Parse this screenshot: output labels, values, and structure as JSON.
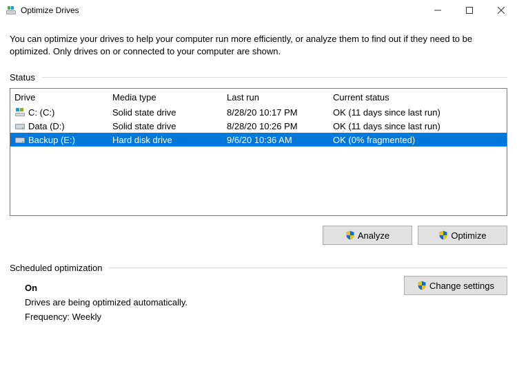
{
  "window": {
    "title": "Optimize Drives"
  },
  "intro": "You can optimize your drives to help your computer run more efficiently, or analyze them to find out if they need to be optimized. Only drives on or connected to your computer are shown.",
  "status_label": "Status",
  "columns": {
    "drive": "Drive",
    "media": "Media type",
    "last": "Last run",
    "status": "Current status"
  },
  "drives": [
    {
      "name": "C: (C:)",
      "media": "Solid state drive",
      "last": "8/28/20 10:17 PM",
      "status": "OK (11 days since last run)",
      "selected": false,
      "icon": "os"
    },
    {
      "name": "Data (D:)",
      "media": "Solid state drive",
      "last": "8/28/20 10:26 PM",
      "status": "OK (11 days since last run)",
      "selected": false,
      "icon": "hdd"
    },
    {
      "name": "Backup (E:)",
      "media": "Hard disk drive",
      "last": "9/6/20 10:36 AM",
      "status": "OK (0% fragmented)",
      "selected": true,
      "icon": "hdd"
    }
  ],
  "buttons": {
    "analyze": "Analyze",
    "optimize": "Optimize",
    "change_settings": "Change settings"
  },
  "scheduled": {
    "heading": "Scheduled optimization",
    "state": "On",
    "desc": "Drives are being optimized automatically.",
    "freq": "Frequency: Weekly"
  }
}
